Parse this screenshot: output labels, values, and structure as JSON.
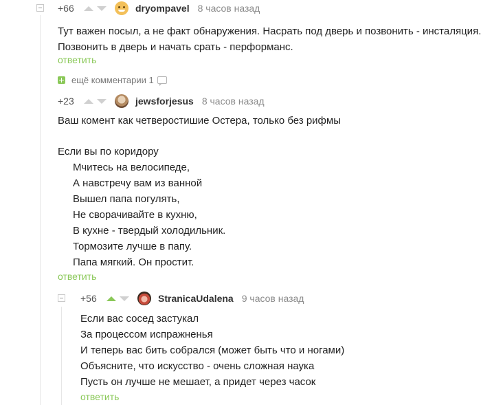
{
  "comments": [
    {
      "rating": "+66",
      "username": "dryompavel",
      "time": "8 часов назад",
      "avatar": "emoji-face-icon",
      "text": "Тут важен посыл, а не факт обнаружения. Насрать под дверь и позвонить - инсталяция.\nПозвонить в дверь и начать срать - перформанс.",
      "reply": "ответить"
    },
    {
      "rating": "+23",
      "username": "jewsforjesus",
      "time": "8 часов назад",
      "avatar": "user-photo-icon",
      "text": "Ваш комент как четверостишие Остера, только без рифмы",
      "poem_title": "Если вы по коридору",
      "poem_lines": "Мчитесь на велосипеде,\nА навстречу вам из ванной\nВышел папа погулять,\nНе сворачивайте в кухню,\nВ кухне - твердый холодильник.\nТормозите лучше в папу.\nПапа мягкий. Он простит.",
      "reply": "ответить"
    },
    {
      "rating": "+56",
      "username": "StranicaUdalena",
      "time": "9 часов назад",
      "avatar": "user-photo-icon",
      "text": "Если вас сосед застукал\nЗа процессом испражненья\nИ теперь вас бить собрался (может быть что и ногами)\nОбъясните, что искусство - очень сложная наука\nПусть он лучше не мешает, а придет через часок",
      "reply": "ответить"
    }
  ],
  "more_comments": {
    "label": "ещё комментарии",
    "count": "1"
  },
  "colors": {
    "accent": "#8ac858",
    "muted": "#8a8a8a"
  }
}
